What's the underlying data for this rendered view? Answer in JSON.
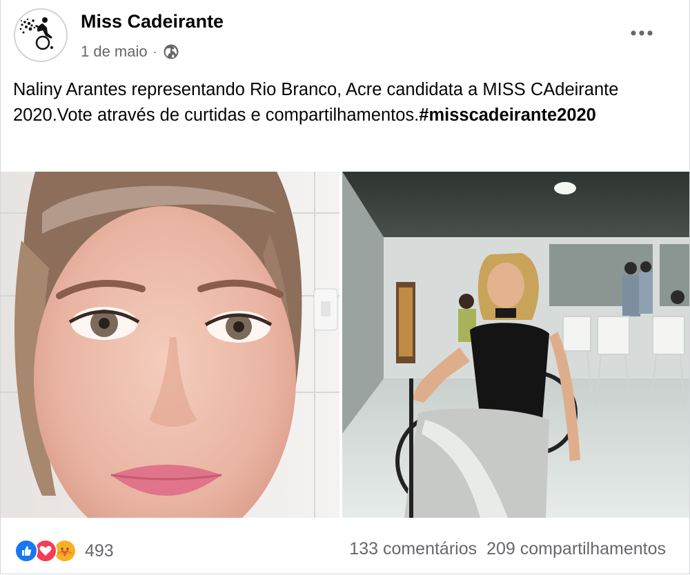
{
  "post": {
    "page_name": "Miss Cadeirante",
    "date": "1 de maio",
    "separator": "·",
    "privacy_icon": "globe-icon",
    "text_main": "Naliny Arantes representando Rio Branco,  Acre candidata a MISS CAdeirante 2020.Vote através de curtidas e compartilhamentos.",
    "hashtag": "#misscadeirante2020"
  },
  "photos": [
    {
      "name": "selfie-photo"
    },
    {
      "name": "wheelchair-photo"
    }
  ],
  "footer": {
    "reaction_icons": [
      "like-icon",
      "love-icon",
      "care-icon"
    ],
    "reaction_count": "493",
    "comments": "133 comentários",
    "shares": "209 compartilhamentos"
  },
  "colors": {
    "like_blue": "#1877f2",
    "love_red": "#f33e58",
    "care_yellow": "#f7b125",
    "secondary_text": "#65676b"
  }
}
